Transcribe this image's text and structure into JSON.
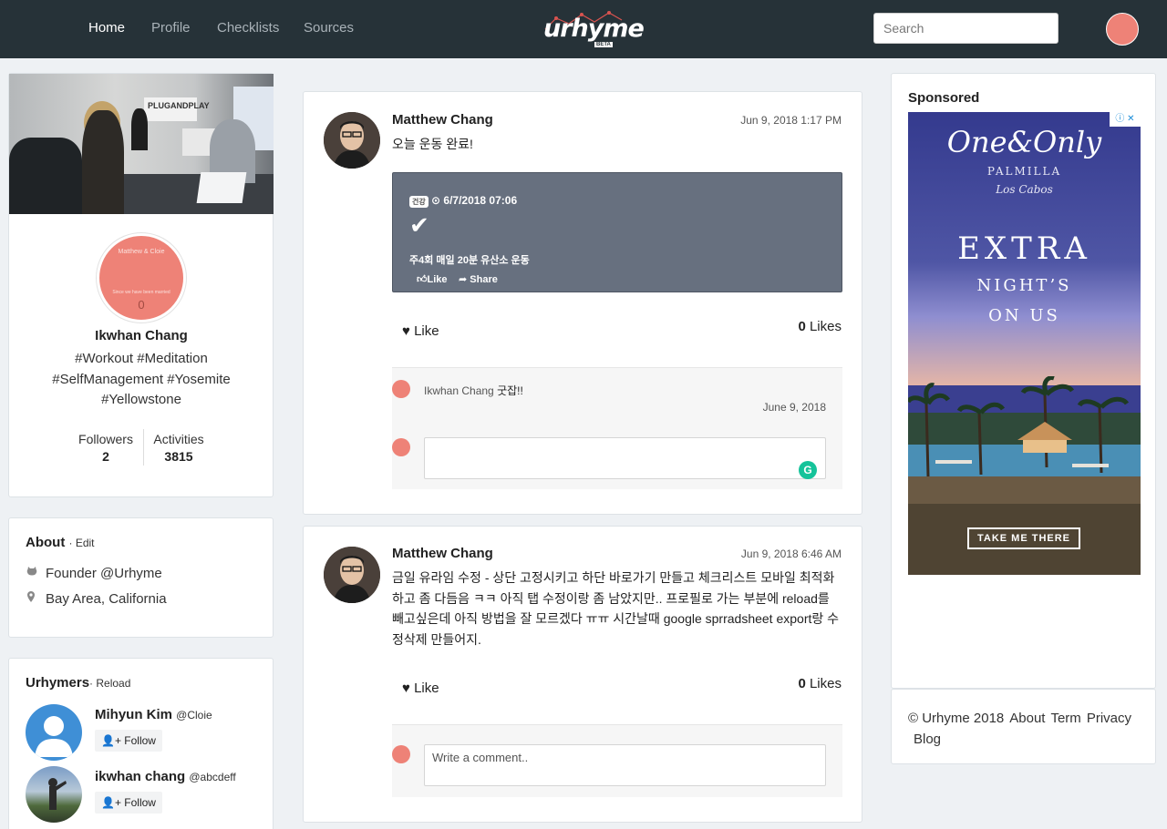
{
  "nav": {
    "items": [
      "Home",
      "Profile",
      "Checklists",
      "Sources"
    ],
    "logo": "urhyme",
    "logo_badge": "BETA",
    "search_placeholder": "Search"
  },
  "profile": {
    "cover_sign": "PLUGANDPLAY",
    "avatar_title": "Matthew & Cloie",
    "avatar_subtitle": "Since we have been married",
    "avatar_number": "0",
    "name": "Ikwhan Chang",
    "tags": "#Workout #Meditation #SelfManagement #Yosemite #Yellowstone",
    "followers_label": "Followers",
    "followers": "2",
    "activities_label": "Activities",
    "activities": "3815"
  },
  "about": {
    "title": "About",
    "edit": "· Edit",
    "rows": [
      {
        "icon": "github-icon",
        "text": "Founder @Urhyme"
      },
      {
        "icon": "map-pin-icon",
        "text": "Bay Area, California"
      }
    ]
  },
  "urhymers": {
    "title": "Urhymers",
    "reload": "· Reload",
    "users": [
      {
        "name": "Mihyun Kim",
        "handle": "@Cloie",
        "follow": "Follow"
      },
      {
        "name": "ikwhan chang",
        "handle": "@abcdeff",
        "follow": "Follow"
      }
    ]
  },
  "posts": [
    {
      "author": "Matthew Chang",
      "time": "Jun 9, 2018 1:17 PM",
      "text": "오늘 운동 완료!",
      "embed": {
        "badge": "건강",
        "date": "⊙ 6/7/2018 07:06",
        "check": "✔",
        "text": "주4회 매일 20분 유산소 운동",
        "like": "Like",
        "share": "Share"
      },
      "like_label": "Like",
      "likes_count": "0",
      "likes_label": "Likes",
      "comment": {
        "author": "Ikwhan Chang",
        "text": "굿잡!!",
        "date": "June 9, 2018"
      },
      "comment_placeholder": ""
    },
    {
      "author": "Matthew Chang",
      "time": "Jun 9, 2018 6:46 AM",
      "text": "금일 유라임 수정 - 상단 고정시키고 하단 바로가기 만들고 체크리스트 모바일 최적화하고 좀 다듬음 ㅋㅋ 아직 탭 수정이랑 좀 남았지만.. 프로필로 가는 부분에 reload를 빼고싶은데 아직 방법을 잘 모르겠다 ㅠㅠ 시간날때 google sprradsheet export랑 수정삭제 만들어지.",
      "like_label": "Like",
      "likes_count": "0",
      "likes_label": "Likes",
      "comment_placeholder": "Write a comment.."
    }
  ],
  "sponsored": {
    "title": "Sponsored",
    "ad_brand": "One&Only",
    "ad_sub1": "PALMILLA",
    "ad_sub2": "Los Cabos",
    "ad_line1": "EXTRA",
    "ad_line2": "NIGHT’S",
    "ad_line3": "ON US",
    "ad_cta": "TAKE ME THERE"
  },
  "footer": {
    "copyright": "© Urhyme 2018",
    "links": [
      "About",
      "Term",
      "Privacy",
      "Blog"
    ]
  }
}
